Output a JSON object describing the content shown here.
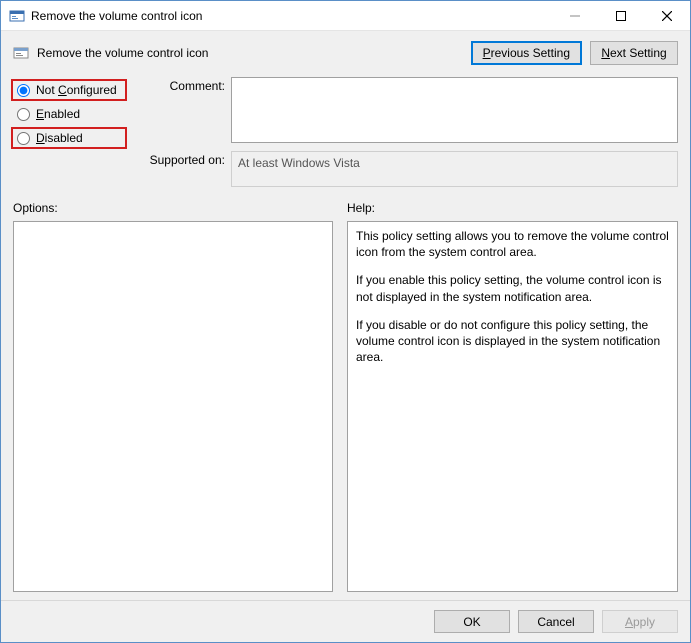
{
  "window": {
    "title": "Remove the volume control icon"
  },
  "header": {
    "title": "Remove the volume control icon",
    "prev_label": "Previous Setting",
    "next_label": "Next Setting"
  },
  "radios": {
    "not_configured": "Not Configured",
    "enabled": "Enabled",
    "disabled": "Disabled",
    "selected": "not_configured"
  },
  "fields": {
    "comment_label": "Comment:",
    "comment_value": "",
    "supported_label": "Supported on:",
    "supported_value": "At least Windows Vista"
  },
  "labels": {
    "options": "Options:",
    "help": "Help:"
  },
  "help": {
    "p1": "This policy setting allows you to remove the volume control icon from the system control area.",
    "p2": "If you enable this policy setting, the volume control icon is not displayed in the system notification area.",
    "p3": "If you disable or do not configure this policy setting, the volume control icon is displayed in the system notification area."
  },
  "footer": {
    "ok": "OK",
    "cancel": "Cancel",
    "apply": "Apply"
  }
}
